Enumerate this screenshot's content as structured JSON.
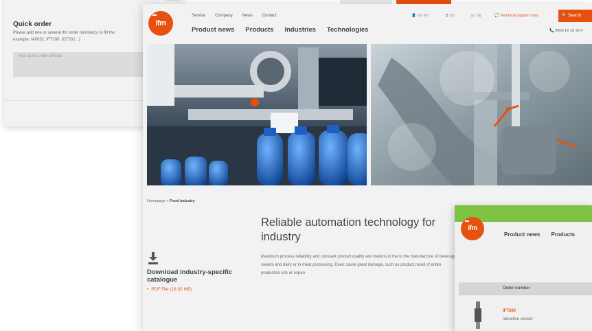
{
  "quick_order": {
    "title": "Quick order",
    "description": "Please add one or several ifm order number(s) to fill the",
    "example": "example: IA0032, IFT200, IGT202...)",
    "input_placeholder": "Your quick order articles"
  },
  "header": {
    "logo_text": "ifm",
    "top_links": [
      "Service",
      "Company",
      "News",
      "Contact"
    ],
    "main_nav": [
      "Product news",
      "Products",
      "Industries",
      "Technologies"
    ],
    "my_ifm": "my ifm",
    "compare_count": "(0)",
    "cart_count": "(0)",
    "support_chat": "Technical support chat",
    "search_label": "Search",
    "phone": "0800 16 16 16 4"
  },
  "breadcrumb": {
    "home": "Homepage",
    "separator": "»",
    "current": "Food industry"
  },
  "content": {
    "headline": "Reliable automation technology for industry",
    "body": "Maximum process reliability and constant product quality are maxims in the fo the manufacture of beverages, sweets and dairy or in meat processing. Even cause great damage, such as product recall of entire production lots or expen"
  },
  "download": {
    "title": "Download industry-specific catalogue",
    "link_label": "PDF File (18.82 MB)"
  },
  "overlay": {
    "nav": [
      "Product news",
      "Products"
    ],
    "table_header": "Order number",
    "product_code": "IFT200",
    "product_desc": "Inductive sensor"
  },
  "colors": {
    "accent": "#e8500f",
    "green_bar": "#7dc242"
  }
}
